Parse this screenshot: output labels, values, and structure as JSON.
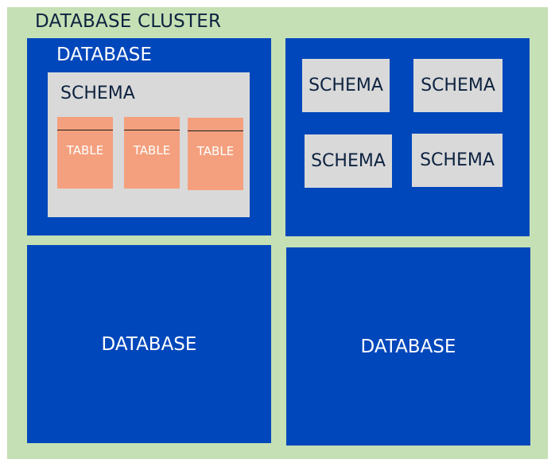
{
  "cluster": {
    "title": "DATABASE CLUSTER"
  },
  "databases": [
    {
      "title": "DATABASE",
      "schema": {
        "title": "SCHEMA",
        "tables": [
          "TABLE",
          "TABLE",
          "TABLE"
        ]
      }
    },
    {
      "schemas": [
        "SCHEMA",
        "SCHEMA",
        "SCHEMA",
        "SCHEMA"
      ]
    },
    {
      "title": "DATABASE"
    },
    {
      "title": "DATABASE"
    }
  ],
  "colors": {
    "cluster_bg": "#c5e0b4",
    "database_bg": "#0047bb",
    "schema_bg": "#d9d9d9",
    "table_bg": "#f4a07e",
    "dark_text": "#0d2240",
    "light_text": "#ffffff"
  }
}
